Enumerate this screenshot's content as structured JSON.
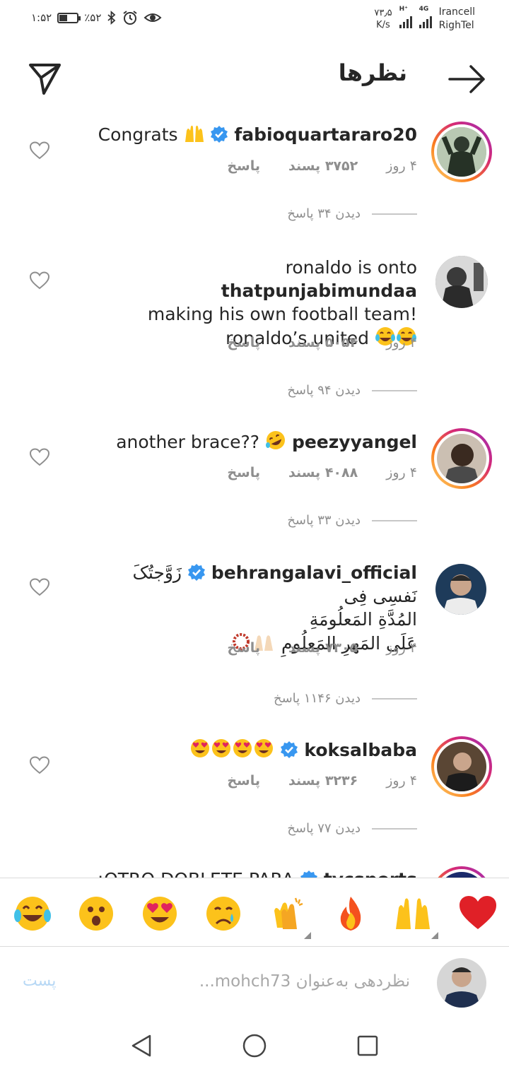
{
  "status_bar": {
    "time": "۱:۵۲",
    "battery": "٪۵۲",
    "battery_level": 0.52,
    "speed_value": "۷۳٫۵",
    "speed_unit": "K/s",
    "network_h": "H⁺",
    "network_4g": "4G",
    "carrier1": "Irancell",
    "carrier2": "RighTel"
  },
  "header": {
    "title": "نظرها"
  },
  "comments": [
    {
      "username": "fabioquartararo20",
      "verified": true,
      "text": "Congrats",
      "age": "۴ روز",
      "likes": "۳۷۵۲ پسند",
      "reply": "پاسخ",
      "view_replies": "دیدن ۳۴ پاسخ"
    },
    {
      "username": "thatpunjabimundaa",
      "verified": false,
      "text_pre": "ronaldo is onto",
      "text_post": "making his own football team!",
      "text_line3": "ronaldo’s united",
      "age": "۴ روز",
      "likes": "۵۰۵۴ پسند",
      "reply": "پاسخ",
      "view_replies": "دیدن ۹۴ پاسخ"
    },
    {
      "username": "peezyyangel",
      "verified": false,
      "text": "another brace??",
      "age": "۴ روز",
      "likes": "۴۰۸۸ پسند",
      "reply": "پاسخ",
      "view_replies": "دیدن ۳۳ پاسخ"
    },
    {
      "username": "behrangalavi_official",
      "verified": true,
      "text_line1": "زَوَّجتُکَ نَفسِی فِی",
      "text_line2": "المُدَّةِ المَعلُومَةِ",
      "text_line3": "عَلَی المَهرِ المَعلُومِ",
      "age": "۴ روز",
      "likes": "۷۳۰۵ پسند",
      "reply": "پاسخ",
      "view_replies": "دیدن ۱۱۴۶ پاسخ"
    },
    {
      "username": "koksalbaba",
      "verified": true,
      "age": "۴ روز",
      "likes": "۳۲۳۶ پسند",
      "reply": "پاسخ",
      "view_replies": "دیدن ۷۷ پاسخ"
    },
    {
      "username": "tycsports",
      "verified": true,
      "text": "¡OTRO DOBLETE PARA"
    }
  ],
  "emoji_bar": [
    "red-heart",
    "raising-hands",
    "fire",
    "clapping-hands",
    "crying-face",
    "heart-eyes",
    "astonished-face",
    "tears-of-joy"
  ],
  "compose": {
    "placeholder": "نظردهی به‌عنوان mohch73...",
    "post_label": "پست"
  },
  "colors": {
    "verified_blue": "#3897f0",
    "muted_text": "#8e8e8e",
    "post_disabled": "#b7d8f5"
  }
}
